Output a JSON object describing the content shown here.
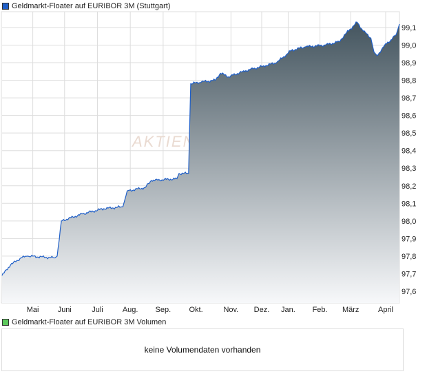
{
  "chart_data": {
    "type": "area",
    "title": "Geldmarkt-Floater auf EURIBOR 3M (Stuttgart)",
    "xlabel": "",
    "ylabel": "",
    "ylim": [
      97.54,
      99.19
    ],
    "yticks": [
      97.6,
      97.7,
      97.8,
      97.9,
      98.0,
      98.1,
      98.2,
      98.3,
      98.4,
      98.5,
      98.6,
      98.7,
      98.8,
      98.9,
      99.0,
      99.1
    ],
    "ytick_labels": [
      "97,6",
      "97,7",
      "97,8",
      "97,9",
      "98,0",
      "98,1",
      "98,2",
      "98,3",
      "98,4",
      "98,5",
      "98,6",
      "98,7",
      "98,8",
      "98,9",
      "99,0",
      "99,1"
    ],
    "xlim_days": [
      0,
      375
    ],
    "xticks": [
      {
        "label": "Mai",
        "day": 29
      },
      {
        "label": "Juni",
        "day": 59
      },
      {
        "label": "Juli",
        "day": 90
      },
      {
        "label": "Aug.",
        "day": 121
      },
      {
        "label": "Sep.",
        "day": 152
      },
      {
        "label": "Okt.",
        "day": 183
      },
      {
        "label": "Nov.",
        "day": 216
      },
      {
        "label": "Dez.",
        "day": 245
      },
      {
        "label": "Jan.",
        "day": 270
      },
      {
        "label": "Feb.",
        "day": 300
      },
      {
        "label": "März",
        "day": 329
      },
      {
        "label": "April",
        "day": 362
      }
    ],
    "x_days": [
      0,
      8,
      18,
      24,
      50,
      52,
      56,
      76,
      96,
      114,
      118,
      135,
      141,
      165,
      167,
      176,
      178,
      188,
      201,
      206,
      214,
      227,
      246,
      259,
      273,
      286,
      305,
      318,
      325,
      335,
      341,
      348,
      351,
      354,
      361,
      367,
      372,
      375
    ],
    "values": [
      97.69,
      97.75,
      97.79,
      97.8,
      97.79,
      97.8,
      98.0,
      98.04,
      98.07,
      98.08,
      98.17,
      98.19,
      98.23,
      98.24,
      98.27,
      98.27,
      98.78,
      98.79,
      98.8,
      98.84,
      98.82,
      98.85,
      98.88,
      98.9,
      98.97,
      98.99,
      99.0,
      99.02,
      99.07,
      99.13,
      99.08,
      99.04,
      98.96,
      98.94,
      99.0,
      99.03,
      99.06,
      99.12
    ],
    "grid": true,
    "line_color": "#1f5fc8",
    "watermark": "AKTIEN"
  },
  "volume": {
    "title": "Geldmarkt-Floater auf EURIBOR 3M Volumen",
    "empty_text": "keine Volumendaten vorhanden",
    "color": "#5cc85c"
  }
}
